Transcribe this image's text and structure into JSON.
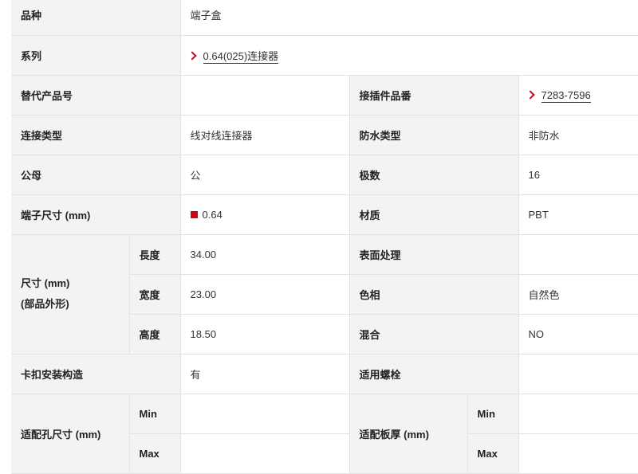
{
  "rows": {
    "r1": {
      "label": "品种",
      "value": "端子盒"
    },
    "r2": {
      "label": "系列",
      "value": "0.64(025)连接器",
      "icon": "chevron-right-icon"
    },
    "r3": {
      "label_l": "替代产品号",
      "value_l": "",
      "label_r": "接插件品番",
      "value_r": "7283-7596",
      "icon_r": "chevron-right-icon"
    },
    "r4": {
      "label_l": "连接类型",
      "value_l": "线对线连接器",
      "label_r": "防水类型",
      "value_r": "非防水"
    },
    "r5": {
      "label_l": "公母",
      "value_l": "公",
      "label_r": "极数",
      "value_r": "16"
    },
    "r6": {
      "label_l": "端子尺寸 (mm)",
      "value_l": "0.64",
      "swatch_color": "#d0021b",
      "label_r": "材质",
      "value_r": "PBT"
    },
    "dims": {
      "label_line1": "尺寸 (mm)",
      "label_line2": "(部品外形)",
      "length_label": "長度",
      "length_value": "34.00",
      "width_label": "宽度",
      "width_value": "23.00",
      "height_label": "高度",
      "height_value": "18.50",
      "surface_label": "表面处理",
      "surface_value": "",
      "color_label": "色相",
      "color_value": "自然色",
      "mix_label": "混合",
      "mix_value": "NO"
    },
    "r10": {
      "label_l": "卡扣安装构造",
      "value_l": "有",
      "label_r": "适用螺栓",
      "value_r": ""
    },
    "fit": {
      "hole_label": "适配孔尺寸 (mm)",
      "hole_min_label": "Min",
      "hole_min_value": "",
      "hole_max_label": "Max",
      "hole_max_value": "",
      "plate_label": "适配板厚 (mm)",
      "plate_min_label": "Min",
      "plate_min_value": "",
      "plate_max_label": "Max",
      "plate_max_value": ""
    }
  },
  "colors": {
    "accent": "#d0021b",
    "label_bg": "#f3f3f3",
    "border": "#e2e2e2"
  }
}
